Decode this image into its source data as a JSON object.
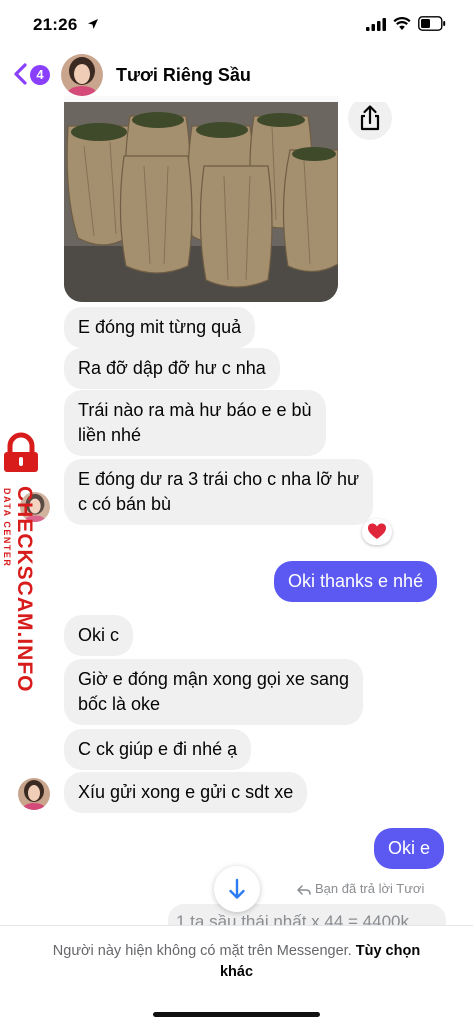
{
  "status_bar": {
    "time": "21:26"
  },
  "header": {
    "back_count": "4",
    "contact_name": "Tươi Riêng Sầu"
  },
  "messages": [
    {
      "text": "E đóng mit từng quả"
    },
    {
      "text": "Ra đỡ dập đỡ hư c nha"
    },
    {
      "text": "Trái nào ra mà hư báo e e bù\nliền nhé"
    },
    {
      "text": "E đóng dư ra 3 trái cho c nha lỡ hư\nc có bán bù"
    },
    {
      "text": "Oki thanks e nhé"
    },
    {
      "text": "Oki c"
    },
    {
      "text": "Giờ e đóng mận xong gọi xe sang\nbốc là oke"
    },
    {
      "text": "C ck giúp e đi nhé ạ"
    },
    {
      "text": "Xíu gửi xong e gửi c sdt xe"
    },
    {
      "text": "Oki e"
    }
  ],
  "reaction": {
    "emoji": "❤️"
  },
  "reply": {
    "label": "Bạn đã trả lời Tươi",
    "quoted_text": "1 ta sầu thái nhất x 44 = 4400k"
  },
  "footer": {
    "notice": "Người này hiện không có mặt trên Messenger.",
    "action": "Tùy chọn khác"
  },
  "watermark": {
    "brand": "CHECKSCAM.INFO",
    "sub": "DATA CENTER"
  }
}
